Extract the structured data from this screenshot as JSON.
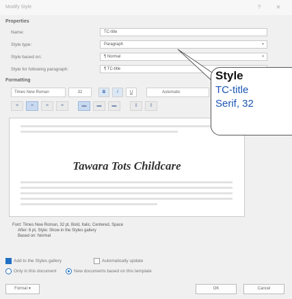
{
  "dialog": {
    "title": "Modify Style",
    "help_glyph": "?",
    "close_glyph": "✕"
  },
  "properties": {
    "section_label": "Properties",
    "name_label": "Name:",
    "name_value": "TC-title",
    "type_label": "Style type:",
    "type_value": "Paragraph",
    "based_label": "Style based on:",
    "based_value": "¶ Normal",
    "following_label": "Style for following paragraph:",
    "following_value": "¶ TC-title"
  },
  "formatting": {
    "section_label": "Formatting",
    "font": "Times New Roman",
    "size": "32",
    "bold_label": "B",
    "italic_label": "I",
    "underline_label": "U",
    "color": "Automatic"
  },
  "preview": {
    "sample_text": "Tawara Tots Childcare"
  },
  "description": {
    "line1": "Font: Times New Roman, 32 pt, Bold, Italic, Centered, Space",
    "line2": "After: 6 pt, Style: Show in the Styles gallery",
    "line3": "Based on: Normal"
  },
  "options": {
    "add_gallery": "Add to the Styles gallery",
    "auto_update": "Automatically update",
    "only_doc": "Only in this document",
    "new_docs": "New documents based on this template"
  },
  "buttons": {
    "format": "Format ▾",
    "ok": "OK",
    "cancel": "Cancel"
  },
  "callout": {
    "title": "Style",
    "line1": "TC-title",
    "line2": "Serif, 32"
  }
}
